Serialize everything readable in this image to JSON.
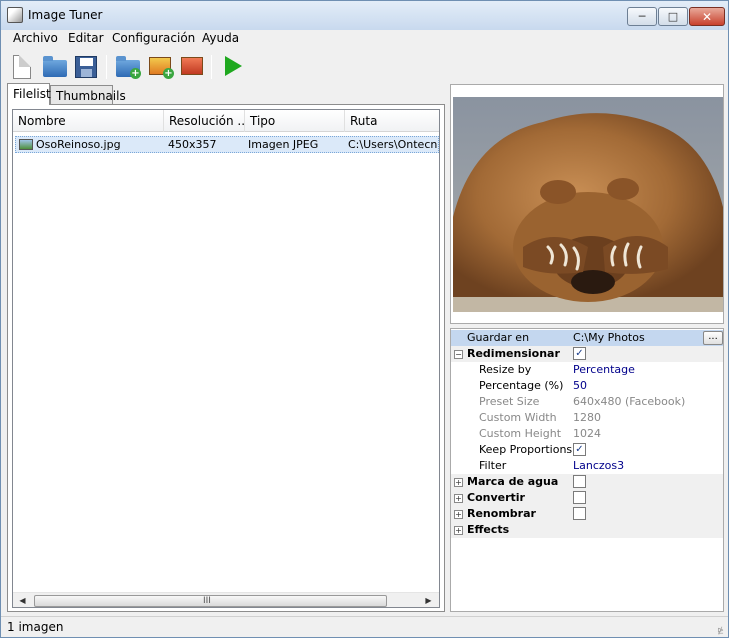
{
  "window": {
    "title": "Image Tuner"
  },
  "menu": [
    "Archivo",
    "Editar",
    "Configuración",
    "Ayuda"
  ],
  "tabs": [
    "Filelist",
    "Thumbnails"
  ],
  "filelist": {
    "columns": [
      "Nombre",
      "Resolución ...",
      "Tipo",
      "Ruta"
    ],
    "rows": [
      {
        "name": "OsoReinoso.jpg",
        "resolution": "450x357",
        "type": "Imagen JPEG",
        "path": "C:\\Users\\Ontecnia\\"
      }
    ],
    "scroll_grip": "III"
  },
  "properties": {
    "save_label": "Guardar en",
    "save_value": "C:\\My Photos",
    "browse_label": "...",
    "resize": {
      "label": "Redimensionar",
      "checked": true,
      "items": [
        {
          "name": "Resize by",
          "value": "Percentage",
          "disabled": false
        },
        {
          "name": "Percentage (%)",
          "value": "50",
          "disabled": false
        },
        {
          "name": "Preset Size",
          "value": "640x480 (Facebook)",
          "disabled": true
        },
        {
          "name": "Custom Width",
          "value": "1280",
          "disabled": true
        },
        {
          "name": "Custom Height",
          "value": "1024",
          "disabled": true
        },
        {
          "name": "Keep Proportions",
          "value": "",
          "checked": true,
          "disabled": false
        },
        {
          "name": "Filter",
          "value": "Lanczos3",
          "disabled": false
        }
      ]
    },
    "categories": [
      {
        "label": "Marca de agua",
        "checkbox": true
      },
      {
        "label": "Convertir",
        "checkbox": true
      },
      {
        "label": "Renombrar",
        "checkbox": true
      },
      {
        "label": "Effects",
        "checkbox": false
      }
    ]
  },
  "status": {
    "text": "1 imagen"
  },
  "colors": {
    "accent": "#c4d7ef",
    "play": "#1fa81f"
  }
}
